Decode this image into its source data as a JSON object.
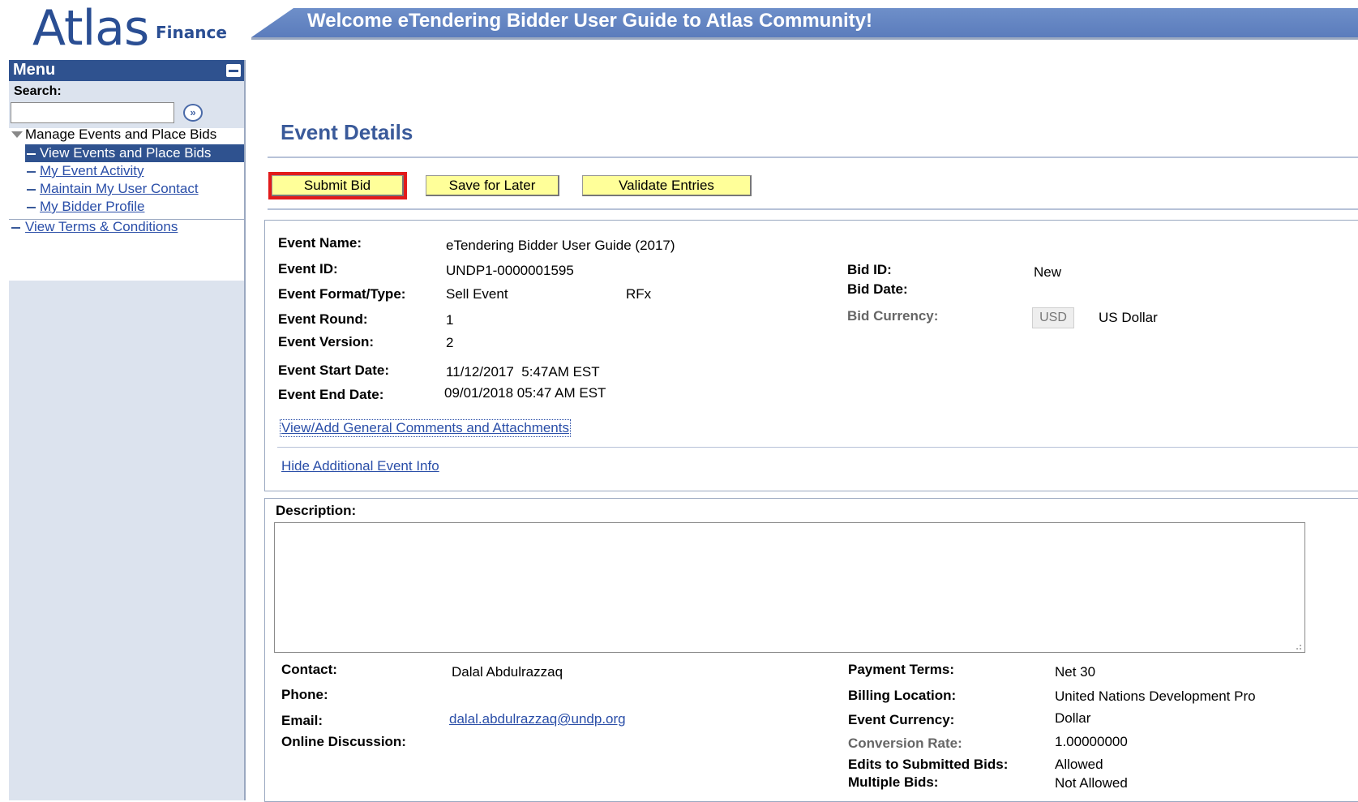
{
  "header": {
    "logo_main": "Atlas",
    "logo_sub": "Finance",
    "banner_text": "Welcome eTendering Bidder User Guide to Atlas Community!"
  },
  "sidebar": {
    "menu_title": "Menu",
    "search_label": "Search:",
    "search_value": "",
    "tree": {
      "manage": "Manage Events and Place Bids",
      "items": [
        "View Events and Place Bids",
        "My Event Activity",
        "Maintain My User Contact",
        "My Bidder Profile"
      ],
      "terms": "View Terms & Conditions"
    }
  },
  "main": {
    "title": "Event Details",
    "buttons": {
      "submit": "Submit Bid",
      "save": "Save for Later",
      "validate": "Validate Entries"
    },
    "event": {
      "name_label": "Event Name:",
      "name_value": "eTendering Bidder User Guide (2017)",
      "id_label": "Event ID:",
      "id_value": "UNDP1-0000001595",
      "format_label": "Event Format/Type:",
      "format_value": "Sell Event",
      "type_value": "RFx",
      "round_label": "Event Round:",
      "round_value": "1",
      "version_label": "Event Version:",
      "version_value": "2",
      "start_label": "Event Start Date:",
      "start_value": "11/12/2017  5:47AM EST",
      "end_label": "Event End Date:",
      "end_value": "09/01/2018 05:47 AM EST",
      "bid_id_label": "Bid ID:",
      "bid_id_value": "New",
      "bid_date_label": "Bid Date:",
      "bid_currency_label": "Bid Currency:",
      "bid_currency_code": "USD",
      "bid_currency_name": "US Dollar",
      "comments_link": "View/Add General Comments and Attachments",
      "hide_link": "Hide Additional Event Info"
    },
    "description": {
      "label": "Description:",
      "value": "",
      "contact_label": "Contact:",
      "contact_value": "Dalal Abdulrazzaq",
      "phone_label": "Phone:",
      "email_label": "Email:",
      "email_value": "dalal.abdulrazzaq@undp.org",
      "discussion_label": "Online Discussion:",
      "payment_label": "Payment Terms:",
      "payment_value": "Net 30",
      "billing_label": "Billing Location:",
      "billing_value": "United Nations Development Pro",
      "currency_label": "Event Currency:",
      "currency_value": "Dollar",
      "rate_label": "Conversion Rate:",
      "rate_value": "1.00000000",
      "edits_label": "Edits to Submitted Bids:",
      "edits_value": "Allowed",
      "multiple_label": "Multiple Bids:",
      "multiple_value": "Not Allowed"
    }
  }
}
